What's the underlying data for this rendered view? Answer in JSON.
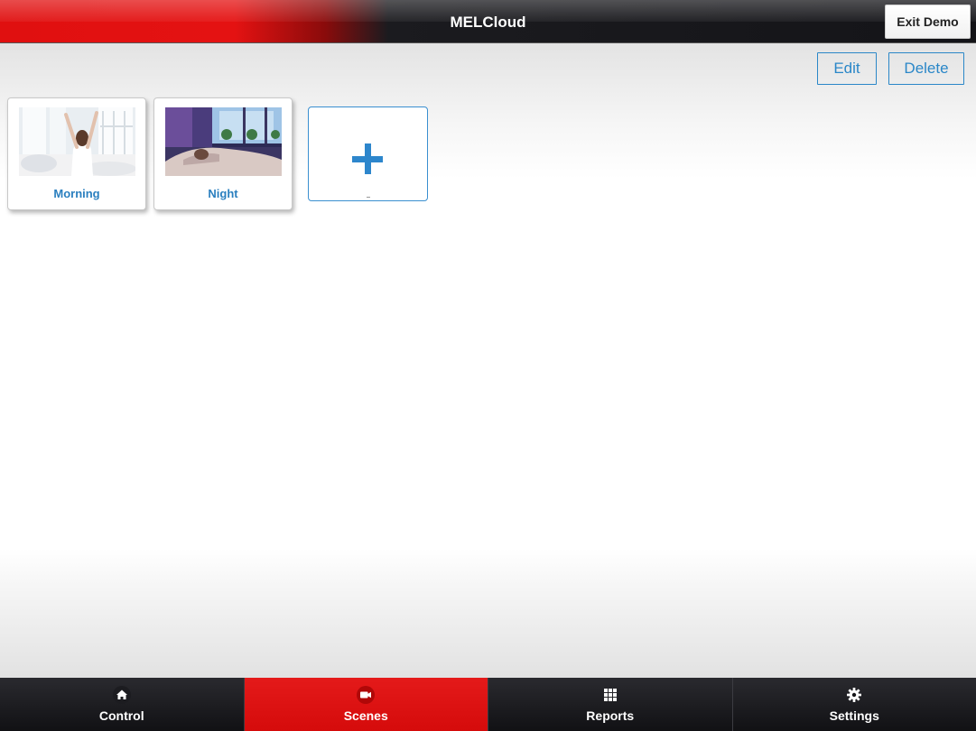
{
  "header": {
    "title": "MELCloud",
    "exit_label": "Exit Demo"
  },
  "actions": {
    "edit_label": "Edit",
    "delete_label": "Delete"
  },
  "scenes": [
    {
      "label": "Morning",
      "image": "woman-waking-photo"
    },
    {
      "label": "Night",
      "image": "person-sleeping-photo"
    }
  ],
  "add_scene": {
    "icon": "plus-icon"
  },
  "tabs": [
    {
      "label": "Control",
      "icon": "home-icon",
      "active": false
    },
    {
      "label": "Scenes",
      "icon": "video-camera-icon",
      "active": true
    },
    {
      "label": "Reports",
      "icon": "grid-icon",
      "active": false
    },
    {
      "label": "Settings",
      "icon": "gear-icon",
      "active": false
    }
  ],
  "colors": {
    "accent": "#2a87c8",
    "brand_red": "#e01010",
    "bar_dark": "#141418"
  }
}
